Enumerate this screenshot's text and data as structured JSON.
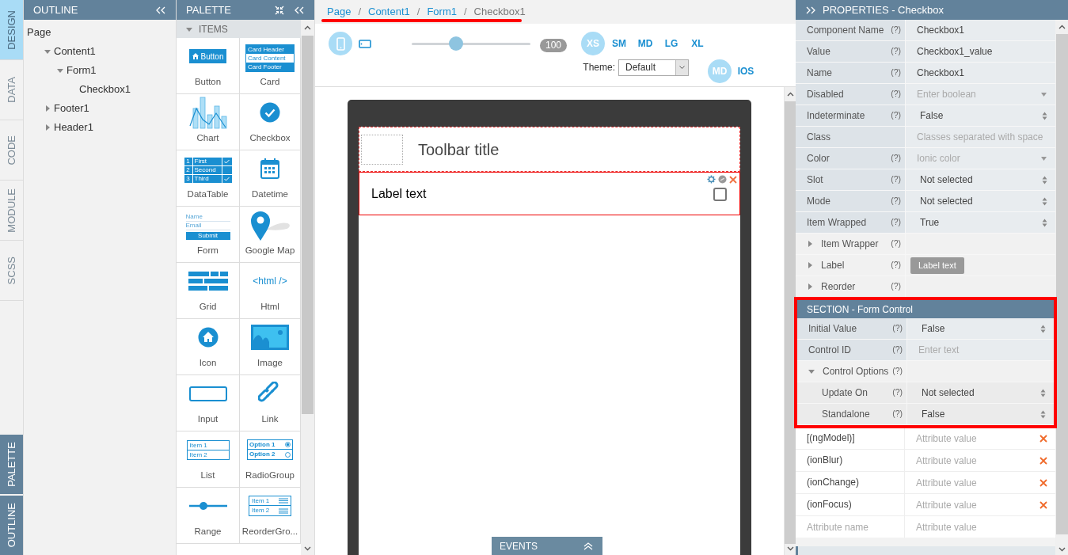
{
  "side_tabs": [
    {
      "label": "DESIGN",
      "selected": true
    },
    {
      "label": "DATA",
      "selected": false
    },
    {
      "label": "CODE",
      "selected": false
    },
    {
      "label": "MODULE",
      "selected": false
    },
    {
      "label": "SCSS",
      "selected": false
    }
  ],
  "bottom_tabs": [
    {
      "label": "PALETTE"
    },
    {
      "label": "OUTLINE"
    }
  ],
  "outline": {
    "title": "OUTLINE",
    "tree": [
      {
        "label": "Page",
        "children": [
          {
            "label": "Content1",
            "expanded": true,
            "children": [
              {
                "label": "Form1",
                "expanded": true,
                "children": [
                  {
                    "label": "Checkbox1"
                  }
                ]
              }
            ]
          },
          {
            "label": "Footer1",
            "expanded": false
          },
          {
            "label": "Header1",
            "expanded": false
          }
        ]
      }
    ]
  },
  "palette": {
    "title": "PALETTE",
    "section": {
      "label": "ITEMS",
      "expanded": true
    },
    "items": [
      {
        "label": "Button",
        "kind": "button",
        "icon_texts": [
          "Button"
        ]
      },
      {
        "label": "Card",
        "kind": "card",
        "icon_texts": [
          "Card Header",
          "Card Content",
          "Card Footer"
        ]
      },
      {
        "label": "Chart",
        "kind": "chart"
      },
      {
        "label": "Checkbox",
        "kind": "checkbox"
      },
      {
        "label": "DataTable",
        "kind": "datatable",
        "icon_texts": [
          "1",
          "First",
          "2",
          "Second",
          "3",
          "Third"
        ]
      },
      {
        "label": "Datetime",
        "kind": "datetime"
      },
      {
        "label": "Form",
        "kind": "form",
        "icon_texts": [
          "Name",
          "Email",
          "Submit"
        ]
      },
      {
        "label": "Google Map",
        "kind": "map"
      },
      {
        "label": "Grid",
        "kind": "grid"
      },
      {
        "label": "Html",
        "kind": "html",
        "icon_texts": [
          "<html />"
        ]
      },
      {
        "label": "Icon",
        "kind": "icon"
      },
      {
        "label": "Image",
        "kind": "image"
      },
      {
        "label": "Input",
        "kind": "input"
      },
      {
        "label": "Link",
        "kind": "link"
      },
      {
        "label": "List",
        "kind": "list",
        "icon_texts": [
          "Item 1",
          "Item 2"
        ]
      },
      {
        "label": "RadioGroup",
        "kind": "radio",
        "icon_texts": [
          "Option 1",
          "Option 2"
        ]
      },
      {
        "label": "Range",
        "kind": "range"
      },
      {
        "label": "ReorderGro...",
        "kind": "reorder",
        "icon_texts": [
          "Item 1",
          "Item 2"
        ]
      }
    ]
  },
  "breadcrumb": [
    {
      "label": "Page",
      "current": false,
      "separator_after": "/"
    },
    {
      "label": "Content1",
      "current": false,
      "separator_after": "/"
    },
    {
      "label": "Form1",
      "current": false,
      "separator_after": "/"
    },
    {
      "label": "Checkbox1",
      "current": true
    }
  ],
  "toolbar": {
    "devices": [
      {
        "kind": "phone",
        "selected": true
      },
      {
        "kind": "tablet",
        "selected": false
      }
    ],
    "zoom": {
      "level": 0.37,
      "reading": "100"
    },
    "sizes": [
      {
        "label": "XS",
        "selected": true
      },
      {
        "label": "SM",
        "selected": false
      },
      {
        "label": "MD",
        "selected": false
      },
      {
        "label": "LG",
        "selected": false
      },
      {
        "label": "XL",
        "selected": false
      }
    ],
    "theme_label": "Theme:",
    "theme_value": "Default",
    "modes": [
      {
        "label": "MD",
        "selected": true
      },
      {
        "label": "IOS",
        "selected": false
      }
    ]
  },
  "canvas": {
    "toolbar_title": "Toolbar title",
    "item_label": "Label text",
    "checkbox_checked": false,
    "events_label": "EVENTS"
  },
  "properties": {
    "title": "PROPERTIES - Checkbox",
    "rows": [
      {
        "kind": "text",
        "label": "Component Name",
        "help": "(?)",
        "value": "Checkbox1"
      },
      {
        "kind": "text",
        "label": "Value",
        "help": "(?)",
        "value": "Checkbox1_value"
      },
      {
        "kind": "text",
        "label": "Name",
        "help": "(?)",
        "value": "Checkbox1"
      },
      {
        "kind": "dropdown",
        "label": "Disabled",
        "help": "(?)",
        "placeholder": "Enter boolean"
      },
      {
        "kind": "select",
        "label": "Indeterminate",
        "help": "(?)",
        "value": "False"
      },
      {
        "kind": "text",
        "label": "Class",
        "placeholder": "Classes separated with space"
      },
      {
        "kind": "dropdown",
        "label": "Color",
        "help": "(?)",
        "placeholder": "Ionic color"
      },
      {
        "kind": "select",
        "label": "Slot",
        "help": "(?)",
        "value": "Not selected"
      },
      {
        "kind": "select",
        "label": "Mode",
        "help": "(?)",
        "value": "Not selected"
      },
      {
        "kind": "select",
        "label": "Item Wrapped",
        "help": "(?)",
        "value": "True"
      },
      {
        "kind": "group",
        "label": "Item Wrapper",
        "help": "(?)",
        "expanded": false
      },
      {
        "kind": "group",
        "label": "Label",
        "help": "(?)",
        "expanded": false,
        "button": "Label text"
      },
      {
        "kind": "group",
        "label": "Reorder",
        "help": "(?)",
        "expanded": false
      }
    ],
    "section": {
      "title": "SECTION - Form Control",
      "rows": [
        {
          "kind": "select",
          "label": "Initial Value",
          "help": "(?)",
          "value": "False"
        },
        {
          "kind": "text",
          "label": "Control ID",
          "help": "(?)",
          "placeholder": "Enter text"
        },
        {
          "kind": "group",
          "label": "Control Options",
          "help": "(?)",
          "expanded": true,
          "children": [
            {
              "kind": "select",
              "label": "Update On",
              "help": "(?)",
              "value": "Not selected"
            },
            {
              "kind": "select",
              "label": "Standalone",
              "help": "(?)",
              "value": "False"
            }
          ]
        }
      ]
    },
    "attributes": [
      {
        "name": "[(ngModel)]",
        "placeholder": "Attribute value",
        "removable": true
      },
      {
        "name": "(ionBlur)",
        "placeholder": "Attribute value",
        "removable": true
      },
      {
        "name": "(ionChange)",
        "placeholder": "Attribute value",
        "removable": true
      },
      {
        "name": "(ionFocus)",
        "placeholder": "Attribute value",
        "removable": true
      }
    ],
    "new_attribute": {
      "name_placeholder": "Attribute name",
      "value_placeholder": "Attribute value"
    }
  }
}
